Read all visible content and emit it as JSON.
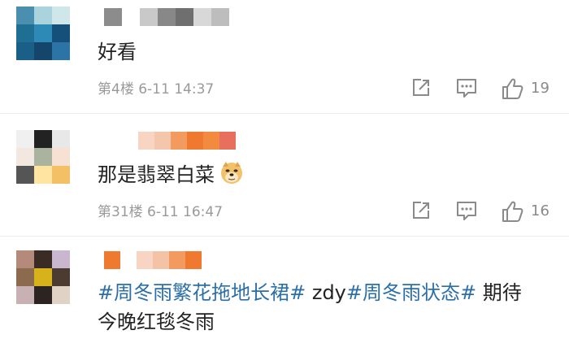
{
  "comments": [
    {
      "text": "好看",
      "floor_time": "第4楼 6-11 14:37",
      "likes": "19",
      "avatar_colors": [
        "#4a8fb0",
        "#a9d3dd",
        "#cfe7ea",
        "#1f6e93",
        "#2d8ab6",
        "#15507a",
        "#1a5f87",
        "#14456b",
        "#2c74a5"
      ]
    },
    {
      "text": "那是翡翠白菜",
      "emoji": "doge-emoji-icon",
      "floor_time": "第31楼 6-11 16:47",
      "likes": "16",
      "avatar_colors": [
        "#f0f0f0",
        "#222222",
        "#e8e8e8",
        "#f3e8e0",
        "#a9b39e",
        "#f7e1d3",
        "#555555",
        "#ffe3a0",
        "#f4c066"
      ]
    },
    {
      "topic1": "#周冬雨繁花拖地长裙#",
      "middle": " zdy",
      "topic2": "#周冬雨状态#",
      "tail": " 期待",
      "line2": "今晚红毯冬雨",
      "avatar_colors": [
        "#b58a7a",
        "#3a2c25",
        "#c9b7cf",
        "#8b6a4e",
        "#d8b21a",
        "#4b3b30",
        "#c8b0b5",
        "#2c2420",
        "#e0d3c6"
      ]
    }
  ],
  "colors": {
    "topic": "#2b6fa8",
    "meta": "#9a9a9a",
    "icon": "#8a8a8a"
  }
}
